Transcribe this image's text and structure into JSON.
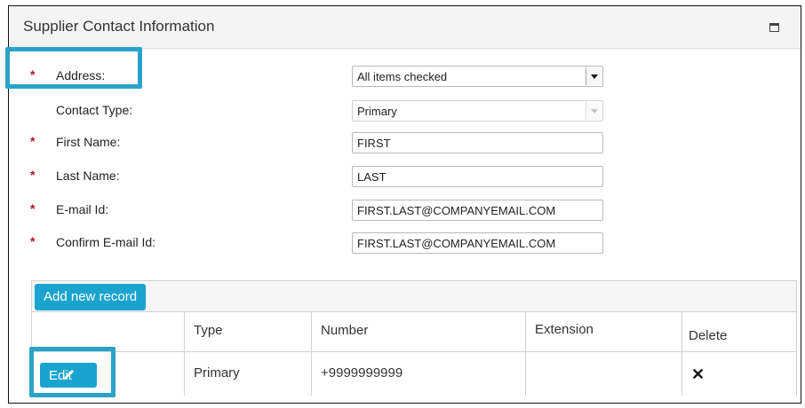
{
  "panel": {
    "title": "Supplier Contact Information",
    "maximize_icon": "maximize-icon"
  },
  "form": {
    "address": {
      "label": "Address:",
      "required": true,
      "value": "All items checked"
    },
    "contact_type": {
      "label": "Contact Type:",
      "required": false,
      "value": "Primary",
      "disabled": true
    },
    "first_name": {
      "label": "First Name:",
      "required": true,
      "value": "FIRST"
    },
    "last_name": {
      "label": "Last Name:",
      "required": true,
      "value": "LAST"
    },
    "email": {
      "label": "E-mail Id:",
      "required": true,
      "value": "FIRST.LAST@COMPANYEMAIL.COM"
    },
    "confirm_email": {
      "label": "Confirm E-mail Id:",
      "required": true,
      "value": "FIRST.LAST@COMPANYEMAIL.COM"
    },
    "required_marker": "*"
  },
  "grid": {
    "add_button": "Add new record",
    "columns": [
      "Type",
      "Number",
      "Extension",
      "Delete"
    ],
    "rows": [
      {
        "edit_label": "Edit",
        "type": "Primary",
        "number": "+9999999999",
        "extension": "",
        "delete_icon": "x-icon",
        "delete_glyph": "✕"
      }
    ]
  },
  "colors": {
    "accent": "#1ba3cf",
    "highlight": "#2aa3c9",
    "required": "#b3122e"
  }
}
